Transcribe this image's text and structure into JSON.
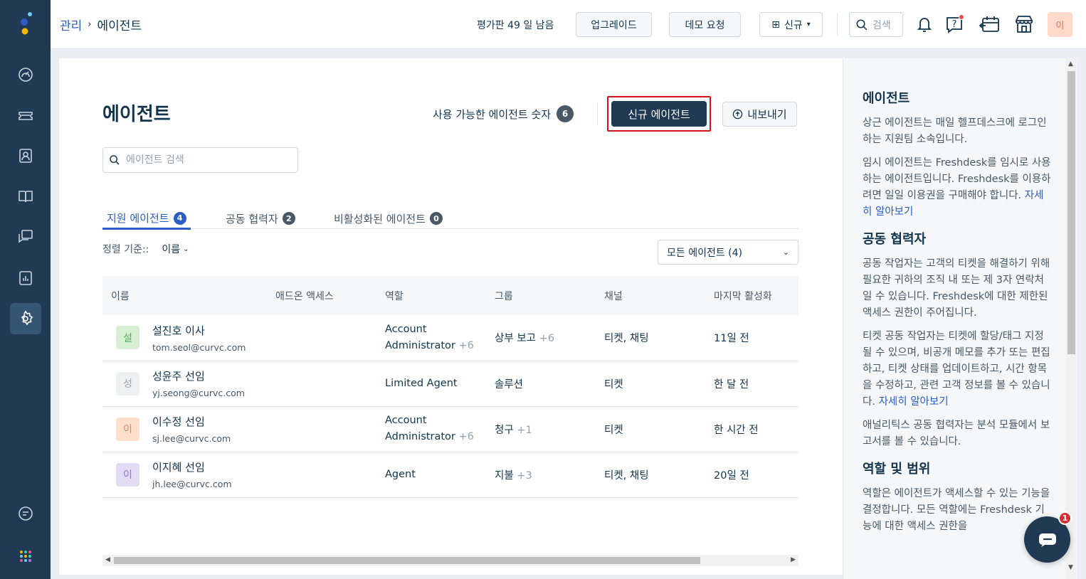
{
  "header": {
    "breadcrumb_parent": "관리",
    "breadcrumb_current": "에이전트",
    "trial_text": "평가판 49 일 남음",
    "upgrade_label": "업그레이드",
    "demo_label": "데모 요청",
    "new_label": "신규",
    "search_label": "검색",
    "user_initial": "이"
  },
  "page": {
    "title": "에이전트",
    "available_label": "사용 가능한 에이전트 숫자",
    "available_count": "6",
    "new_agent_label": "신규 에이전트",
    "export_label": "내보내기",
    "search_placeholder": "에이전트 검색"
  },
  "tabs": [
    {
      "label": "지원 에이전트",
      "count": "4"
    },
    {
      "label": "공동 협력자",
      "count": "2"
    },
    {
      "label": "비활성화된 에이전트",
      "count": "0"
    }
  ],
  "sort": {
    "label": "정렬 기준::",
    "value": "이름"
  },
  "filter": {
    "value": "모든 에이전트 (4)"
  },
  "table": {
    "headers": [
      "이름",
      "애드온 액세스",
      "역할",
      "그룹",
      "채널",
      "마지막 활성화"
    ],
    "rows": [
      {
        "initial": "설",
        "name": "설진호 이사",
        "email": "tom.seol@curvc.com",
        "role_line1": "Account",
        "role_line2": "Administrator",
        "role_extra": "+6",
        "group": "상부 보고",
        "group_extra": "+6",
        "channel": "티켓, 채팅",
        "last_active": "11일 전"
      },
      {
        "initial": "성",
        "name": "성윤주 선임",
        "email": "yj.seong@curvc.com",
        "role_line1": "Limited Agent",
        "role_line2": "",
        "role_extra": "",
        "group": "솔루션",
        "group_extra": "",
        "channel": "티켓",
        "last_active": "한 달 전"
      },
      {
        "initial": "이",
        "name": "이수정 선임",
        "email": "sj.lee@curvc.com",
        "role_line1": "Account",
        "role_line2": "Administrator",
        "role_extra": "+6",
        "group": "청구",
        "group_extra": "+1",
        "channel": "티켓",
        "last_active": "한 시간 전"
      },
      {
        "initial": "이",
        "name": "이지혜 선임",
        "email": "jh.lee@curvc.com",
        "role_line1": "Agent",
        "role_line2": "",
        "role_extra": "",
        "group": "지불",
        "group_extra": "+3",
        "channel": "티켓, 채팅",
        "last_active": "20일 전"
      }
    ]
  },
  "avatar_colors": [
    {
      "bg": "#d7f0d3",
      "fg": "#5ba85a"
    },
    {
      "bg": "#eef0f2",
      "fg": "#9aa7b3"
    },
    {
      "bg": "#ffdecc",
      "fg": "#e0885a"
    },
    {
      "bg": "#e2dcf7",
      "fg": "#8d7ed0"
    }
  ],
  "help": {
    "h1": "에이전트",
    "p1": "상근 에이전트는 매일 헬프데스크에 로그인하는 지원팀 소속입니다.",
    "p2": "임시 에이전트는 Freshdesk를 임시로 사용하는 에이전트입니다. Freshdesk를 이용하려면 일일 이용권을 구매해야 합니다.",
    "p2_link": "자세히 알아보기",
    "h2": "공동 협력자",
    "p3": "공동 작업자는 고객의 티켓을 해결하기 위해 필요한 귀하의 조직 내 또는 제 3자 연락처일 수 있습니다. Freshdesk에 대한 제한된 액세스 권한이 주어집니다.",
    "p4": "티켓 공동 작업자는 티켓에 할당/태그 지정될 수 있으며, 비공개 메모를 추가 또는 편집하고, 티켓 상태를 업데이트하고, 시간 항목을 수정하고, 관련 고객 정보를 볼 수 있습니다.",
    "p4_link": "자세히 알아보기",
    "p5": "애널리틱스 공동 협력자는 분석 모듈에서 보고서를 볼 수 있습니다.",
    "h3": "역할 및 범위",
    "p6": "역할은 에이전트가 액세스할 수 있는 기능을 결정합니다. 모든 역할에는 Freshdesk 기능에 대한 액세스 권한을"
  },
  "chat": {
    "badge": "1"
  },
  "icons": [
    "dashboard-icon",
    "tickets-icon",
    "contacts-icon",
    "solutions-icon",
    "discussions-icon",
    "reports-icon",
    "admin-icon",
    "chat-icon",
    "apps-icon",
    "bell-icon",
    "help-icon",
    "calendar-icon",
    "marketplace-icon"
  ]
}
